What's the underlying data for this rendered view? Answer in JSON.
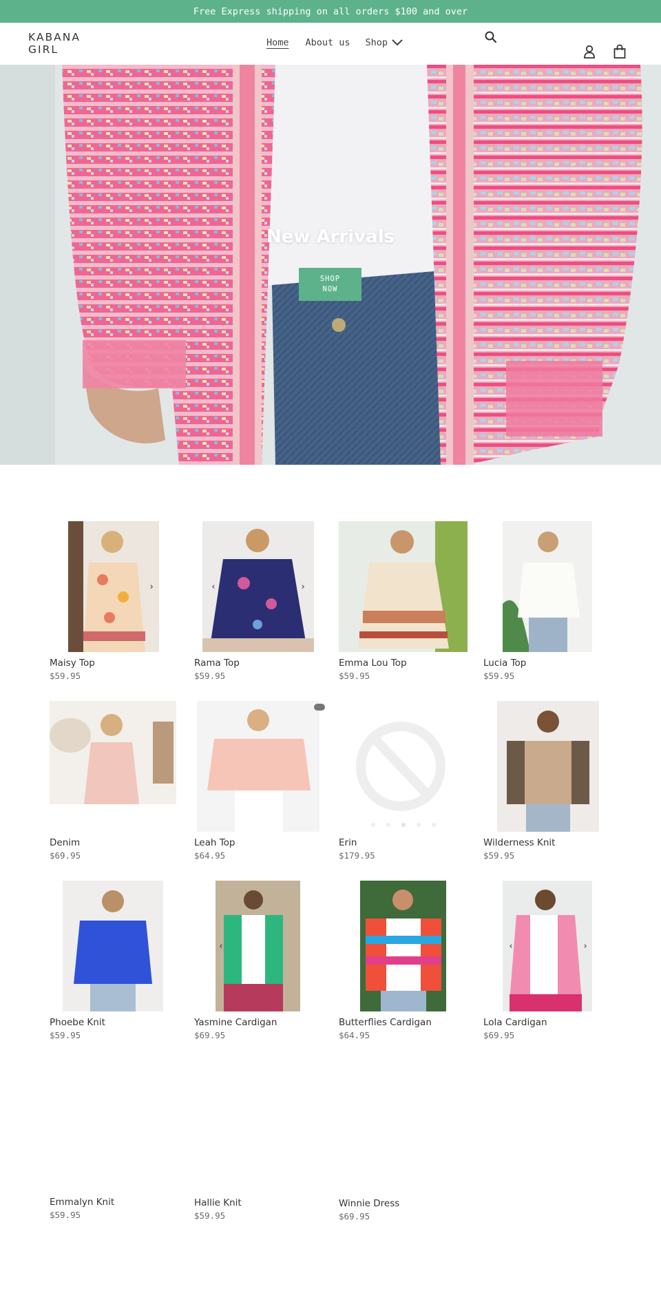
{
  "announcement": "Free Express shipping on all orders $100 and over",
  "header": {
    "logo": "KABANA GIRL",
    "nav": [
      "Home",
      "About us",
      "Shop"
    ]
  },
  "icons": {
    "search": "search-icon",
    "account": "account-icon",
    "cart": "cart-icon",
    "shop_dropdown": "chevron-down-icon"
  },
  "hero": {
    "title": "New Arrivals",
    "button": "SHOP NOW"
  },
  "colors": {
    "accent": "#5db28b"
  },
  "products": [
    {
      "title": "Maisy Top",
      "price": "$59.95"
    },
    {
      "title": "Rama Top",
      "price": "$59.95"
    },
    {
      "title": "Emma Lou Top",
      "price": "$59.95"
    },
    {
      "title": "Lucia Top",
      "price": "$59.95"
    },
    {
      "title": "Denim",
      "price": "$69.95"
    },
    {
      "title": "Leah Top",
      "price": "$64.95"
    },
    {
      "title": "Erin",
      "price": "$179.95"
    },
    {
      "title": "Wilderness Knit",
      "price": "$59.95"
    },
    {
      "title": "Phoebe Knit",
      "price": "$59.95"
    },
    {
      "title": "Yasmine Cardigan",
      "price": "$69.95"
    },
    {
      "title": "Butterflies Cardigan",
      "price": "$64.95"
    },
    {
      "title": "Lola Cardigan",
      "price": "$69.95"
    },
    {
      "title": "Emmalyn Knit",
      "price": "$59.95"
    },
    {
      "title": "Hallie Knit",
      "price": "$59.95"
    },
    {
      "title": "Winnie Dress",
      "price": "$69.95"
    }
  ]
}
